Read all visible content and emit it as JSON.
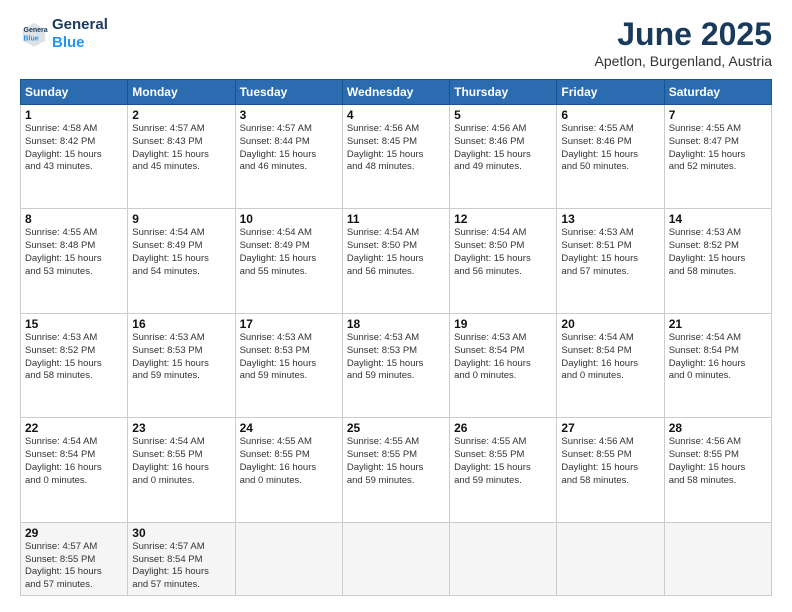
{
  "logo": {
    "line1": "General",
    "line2": "Blue"
  },
  "title": "June 2025",
  "subtitle": "Apetlon, Burgenland, Austria",
  "headers": [
    "Sunday",
    "Monday",
    "Tuesday",
    "Wednesday",
    "Thursday",
    "Friday",
    "Saturday"
  ],
  "weeks": [
    [
      {
        "day": "1",
        "info": "Sunrise: 4:58 AM\nSunset: 8:42 PM\nDaylight: 15 hours\nand 43 minutes."
      },
      {
        "day": "2",
        "info": "Sunrise: 4:57 AM\nSunset: 8:43 PM\nDaylight: 15 hours\nand 45 minutes."
      },
      {
        "day": "3",
        "info": "Sunrise: 4:57 AM\nSunset: 8:44 PM\nDaylight: 15 hours\nand 46 minutes."
      },
      {
        "day": "4",
        "info": "Sunrise: 4:56 AM\nSunset: 8:45 PM\nDaylight: 15 hours\nand 48 minutes."
      },
      {
        "day": "5",
        "info": "Sunrise: 4:56 AM\nSunset: 8:46 PM\nDaylight: 15 hours\nand 49 minutes."
      },
      {
        "day": "6",
        "info": "Sunrise: 4:55 AM\nSunset: 8:46 PM\nDaylight: 15 hours\nand 50 minutes."
      },
      {
        "day": "7",
        "info": "Sunrise: 4:55 AM\nSunset: 8:47 PM\nDaylight: 15 hours\nand 52 minutes."
      }
    ],
    [
      {
        "day": "8",
        "info": "Sunrise: 4:55 AM\nSunset: 8:48 PM\nDaylight: 15 hours\nand 53 minutes."
      },
      {
        "day": "9",
        "info": "Sunrise: 4:54 AM\nSunset: 8:49 PM\nDaylight: 15 hours\nand 54 minutes."
      },
      {
        "day": "10",
        "info": "Sunrise: 4:54 AM\nSunset: 8:49 PM\nDaylight: 15 hours\nand 55 minutes."
      },
      {
        "day": "11",
        "info": "Sunrise: 4:54 AM\nSunset: 8:50 PM\nDaylight: 15 hours\nand 56 minutes."
      },
      {
        "day": "12",
        "info": "Sunrise: 4:54 AM\nSunset: 8:50 PM\nDaylight: 15 hours\nand 56 minutes."
      },
      {
        "day": "13",
        "info": "Sunrise: 4:53 AM\nSunset: 8:51 PM\nDaylight: 15 hours\nand 57 minutes."
      },
      {
        "day": "14",
        "info": "Sunrise: 4:53 AM\nSunset: 8:52 PM\nDaylight: 15 hours\nand 58 minutes."
      }
    ],
    [
      {
        "day": "15",
        "info": "Sunrise: 4:53 AM\nSunset: 8:52 PM\nDaylight: 15 hours\nand 58 minutes."
      },
      {
        "day": "16",
        "info": "Sunrise: 4:53 AM\nSunset: 8:53 PM\nDaylight: 15 hours\nand 59 minutes."
      },
      {
        "day": "17",
        "info": "Sunrise: 4:53 AM\nSunset: 8:53 PM\nDaylight: 15 hours\nand 59 minutes."
      },
      {
        "day": "18",
        "info": "Sunrise: 4:53 AM\nSunset: 8:53 PM\nDaylight: 15 hours\nand 59 minutes."
      },
      {
        "day": "19",
        "info": "Sunrise: 4:53 AM\nSunset: 8:54 PM\nDaylight: 16 hours\nand 0 minutes."
      },
      {
        "day": "20",
        "info": "Sunrise: 4:54 AM\nSunset: 8:54 PM\nDaylight: 16 hours\nand 0 minutes."
      },
      {
        "day": "21",
        "info": "Sunrise: 4:54 AM\nSunset: 8:54 PM\nDaylight: 16 hours\nand 0 minutes."
      }
    ],
    [
      {
        "day": "22",
        "info": "Sunrise: 4:54 AM\nSunset: 8:54 PM\nDaylight: 16 hours\nand 0 minutes."
      },
      {
        "day": "23",
        "info": "Sunrise: 4:54 AM\nSunset: 8:55 PM\nDaylight: 16 hours\nand 0 minutes."
      },
      {
        "day": "24",
        "info": "Sunrise: 4:55 AM\nSunset: 8:55 PM\nDaylight: 16 hours\nand 0 minutes."
      },
      {
        "day": "25",
        "info": "Sunrise: 4:55 AM\nSunset: 8:55 PM\nDaylight: 15 hours\nand 59 minutes."
      },
      {
        "day": "26",
        "info": "Sunrise: 4:55 AM\nSunset: 8:55 PM\nDaylight: 15 hours\nand 59 minutes."
      },
      {
        "day": "27",
        "info": "Sunrise: 4:56 AM\nSunset: 8:55 PM\nDaylight: 15 hours\nand 58 minutes."
      },
      {
        "day": "28",
        "info": "Sunrise: 4:56 AM\nSunset: 8:55 PM\nDaylight: 15 hours\nand 58 minutes."
      }
    ],
    [
      {
        "day": "29",
        "info": "Sunrise: 4:57 AM\nSunset: 8:55 PM\nDaylight: 15 hours\nand 57 minutes."
      },
      {
        "day": "30",
        "info": "Sunrise: 4:57 AM\nSunset: 8:54 PM\nDaylight: 15 hours\nand 57 minutes."
      },
      {
        "day": "",
        "info": ""
      },
      {
        "day": "",
        "info": ""
      },
      {
        "day": "",
        "info": ""
      },
      {
        "day": "",
        "info": ""
      },
      {
        "day": "",
        "info": ""
      }
    ]
  ]
}
